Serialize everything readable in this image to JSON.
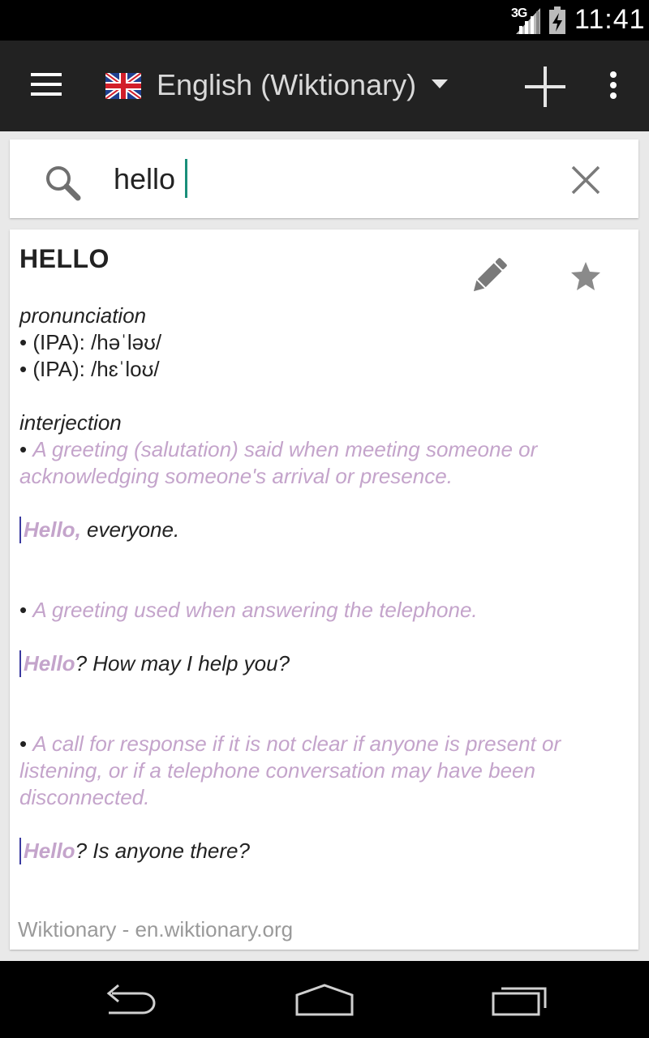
{
  "status_bar": {
    "network": "3G",
    "time": "11:41",
    "icons": [
      "signal-icon",
      "battery-icon"
    ]
  },
  "action_bar": {
    "title": "English (Wiktionary)",
    "icons": [
      "menu-icon",
      "uk-flag-icon",
      "dropdown-icon",
      "add-icon",
      "overflow-menu-icon"
    ]
  },
  "search": {
    "value": "hello",
    "icons": [
      "search-icon",
      "clear-icon"
    ]
  },
  "entry": {
    "headword": "HELLO",
    "pronunciation_label": "pronunciation",
    "pronunciations": [
      "• (IPA): /həˈləʊ/",
      "• (IPA): /hɛˈloʊ/"
    ],
    "pos_label": "interjection",
    "senses": [
      {
        "bullet": "• ",
        "definition": "A greeting (salutation) said when meeting someone or acknowledging someone's arrival or presence.",
        "example_word": "Hello,",
        "example_rest": " everyone."
      },
      {
        "bullet": "• ",
        "definition": "A greeting used when answering the telephone.",
        "example_word": "Hello",
        "example_rest": "? How may I help you?"
      },
      {
        "bullet": "• ",
        "definition": "A call for response if it is not clear if anyone is present or listening, or if a telephone conversation may have been disconnected.",
        "example_word": "Hello",
        "example_rest": "? Is anyone there?"
      }
    ],
    "source": "Wiktionary - en.wiktionary.org",
    "icons": [
      "edit-icon",
      "star-icon"
    ]
  },
  "colors": {
    "action_bar": "#222222",
    "definition_text": "#c4a4cb",
    "cursor": "#1a8f7a",
    "example_rule": "#3a3aa0"
  },
  "nav_bar": {
    "icons": [
      "back-icon",
      "home-icon",
      "recent-apps-icon"
    ]
  }
}
